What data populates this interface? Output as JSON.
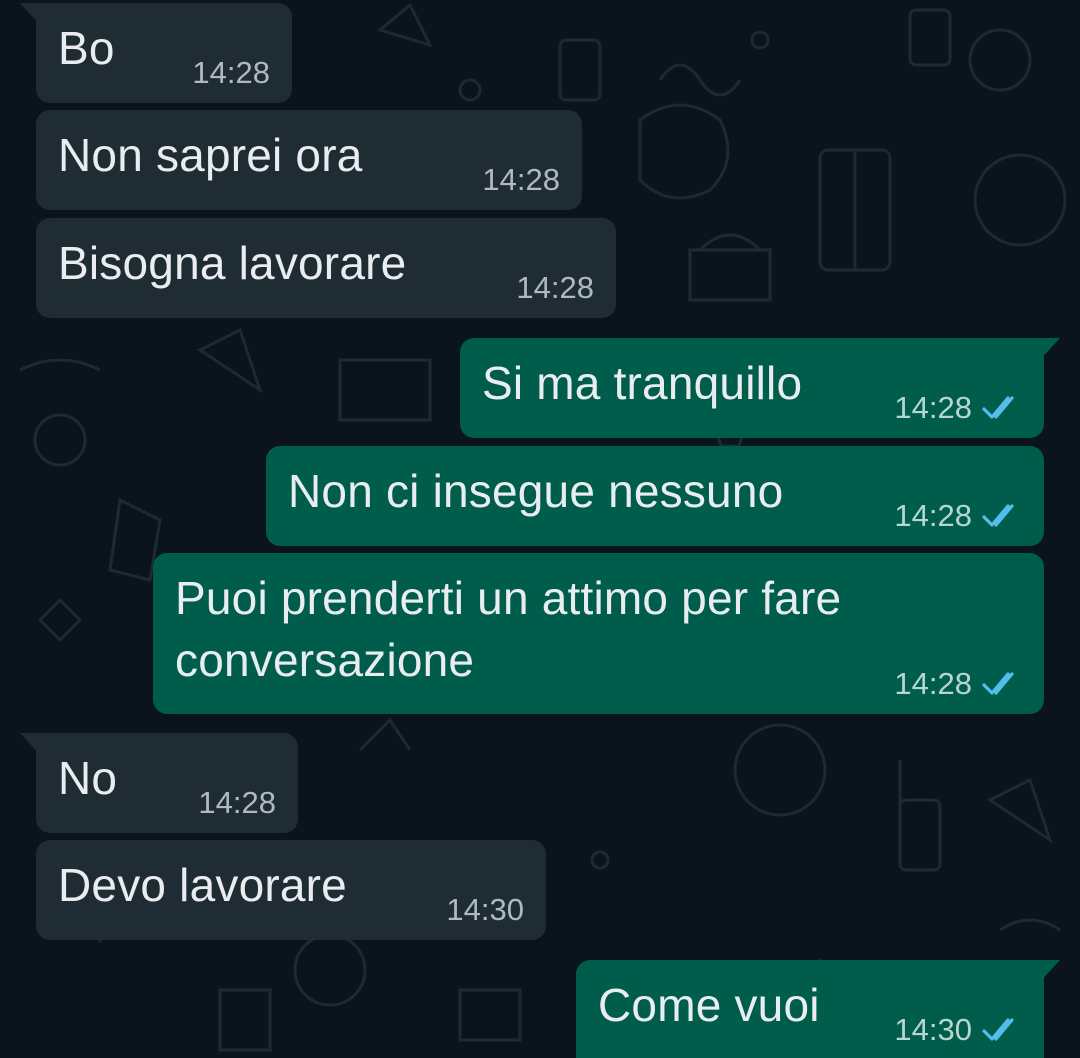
{
  "colors": {
    "background": "#0b141a",
    "incoming_bubble": "#202c33",
    "outgoing_bubble": "#005c4b",
    "text": "#e9edef",
    "read_ticks": "#53bdeb"
  },
  "messages": [
    {
      "direction": "incoming",
      "text": "Bo",
      "time": "14:28"
    },
    {
      "direction": "incoming",
      "text": "Non saprei ora",
      "time": "14:28"
    },
    {
      "direction": "incoming",
      "text": "Bisogna lavorare",
      "time": "14:28"
    },
    {
      "direction": "outgoing",
      "text": "Si ma tranquillo",
      "time": "14:28",
      "status": "read-double-tick-icon"
    },
    {
      "direction": "outgoing",
      "text": "Non ci insegue nessuno",
      "time": "14:28",
      "status": "read-double-tick-icon"
    },
    {
      "direction": "outgoing",
      "lines": [
        "Puoi prenderti un attimo per fare",
        "conversazione"
      ],
      "time": "14:28",
      "status": "read-double-tick-icon"
    },
    {
      "direction": "incoming",
      "text": "No",
      "time": "14:28"
    },
    {
      "direction": "incoming",
      "text": "Devo lavorare",
      "time": "14:30"
    },
    {
      "direction": "outgoing",
      "text": "Come vuoi",
      "time": "14:30",
      "status": "read-double-tick-icon"
    }
  ]
}
